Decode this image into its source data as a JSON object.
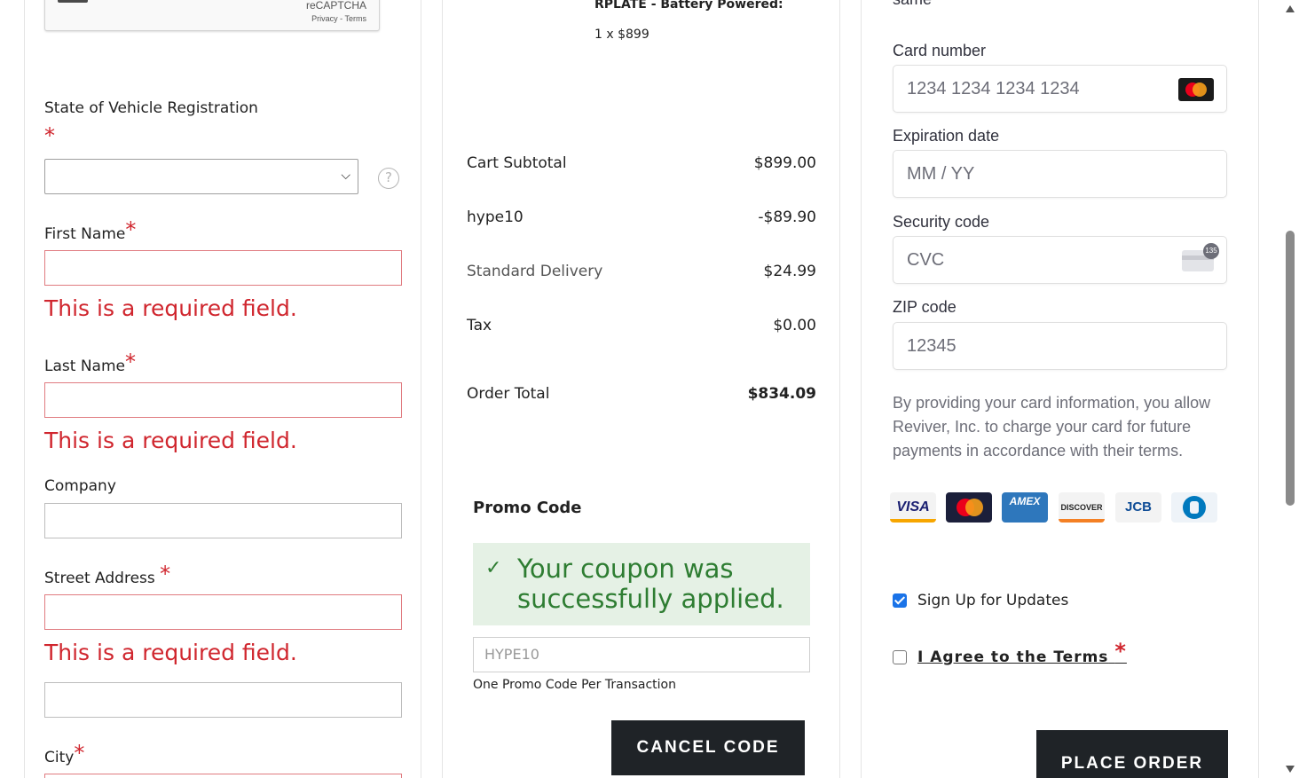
{
  "recaptcha": {
    "title": "reCAPTCHA",
    "links": "Privacy - Terms"
  },
  "billing": {
    "state_label": "State of Vehicle Registration",
    "required_mark": "*",
    "state_value": "",
    "help_glyph": "?",
    "first_name_label": "First Name",
    "last_name_label": "Last Name",
    "company_label": "Company",
    "street_label": "Street Address",
    "city_label": "City",
    "required_error": "This is a required field."
  },
  "order": {
    "product_name": "RPLATE - Battery Powered:",
    "product_qty_price": "1 x $899",
    "rows": [
      {
        "label": "Cart Subtotal",
        "amount": "$899.00"
      },
      {
        "label": "hype10",
        "amount": "-$89.90"
      },
      {
        "label": "Standard Delivery",
        "amount": "$24.99"
      },
      {
        "label": "Tax",
        "amount": "$0.00"
      }
    ],
    "total_label": "Order Total",
    "total_amount": "$834.09"
  },
  "promo": {
    "title": "Promo Code",
    "success_message": "Your coupon was successfully applied.",
    "input_value": "HYPE10",
    "note": "One Promo Code Per Transaction",
    "cancel_label": "CANCEL CODE"
  },
  "payment": {
    "top_partial": "same",
    "card_number_label": "Card number",
    "card_number_placeholder": "1234 1234 1234 1234",
    "expiry_label": "Expiration date",
    "expiry_placeholder": "MM / YY",
    "cvc_label": "Security code",
    "cvc_placeholder": "CVC",
    "cvc_badge": "135",
    "zip_label": "ZIP code",
    "zip_value": "12345",
    "consent": "By providing your card information, you allow Reviver, Inc. to charge your card for future payments in accordance with their terms.",
    "brands": [
      {
        "name": "VISA",
        "bg": "#f3f3f3",
        "fg": "#1a1f71"
      },
      {
        "name": "",
        "bg": "#1b1f3a",
        "fg": "#ffffff"
      },
      {
        "name": "AMEX",
        "bg": "#2e77bc",
        "fg": "#ffffff"
      },
      {
        "name": "DISCOVER",
        "bg": "#f3f3f3",
        "fg": "#222222"
      },
      {
        "name": "JCB",
        "bg": "#f3f3f3",
        "fg": "#0e4c96"
      },
      {
        "name": "",
        "bg": "#eef3f8",
        "fg": "#0079be"
      }
    ],
    "signup_label": "Sign Up for Updates",
    "signup_checked": true,
    "terms_label": "I Agree to the Terms",
    "terms_required": "*",
    "place_order_label": "PLACE ORDER"
  },
  "colors": {
    "error": "#d0262e",
    "success": "#2e7d32",
    "success_bg": "#e5f1e5",
    "button": "#1f2327",
    "checkbox": "#1a73e8"
  }
}
